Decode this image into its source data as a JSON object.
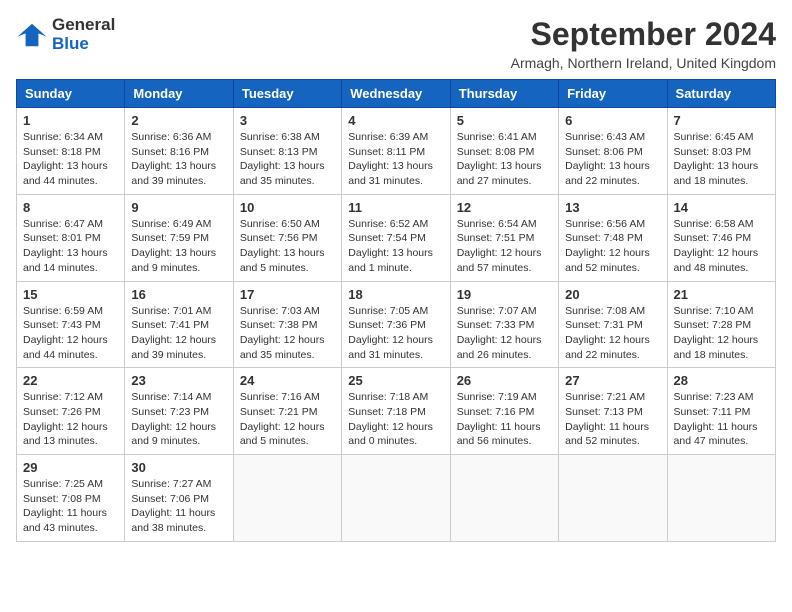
{
  "logo": {
    "line1": "General",
    "line2": "Blue"
  },
  "title": "September 2024",
  "subtitle": "Armagh, Northern Ireland, United Kingdom",
  "days_of_week": [
    "Sunday",
    "Monday",
    "Tuesday",
    "Wednesday",
    "Thursday",
    "Friday",
    "Saturday"
  ],
  "weeks": [
    [
      {
        "day": 1,
        "info": "Sunrise: 6:34 AM\nSunset: 8:18 PM\nDaylight: 13 hours\nand 44 minutes."
      },
      {
        "day": 2,
        "info": "Sunrise: 6:36 AM\nSunset: 8:16 PM\nDaylight: 13 hours\nand 39 minutes."
      },
      {
        "day": 3,
        "info": "Sunrise: 6:38 AM\nSunset: 8:13 PM\nDaylight: 13 hours\nand 35 minutes."
      },
      {
        "day": 4,
        "info": "Sunrise: 6:39 AM\nSunset: 8:11 PM\nDaylight: 13 hours\nand 31 minutes."
      },
      {
        "day": 5,
        "info": "Sunrise: 6:41 AM\nSunset: 8:08 PM\nDaylight: 13 hours\nand 27 minutes."
      },
      {
        "day": 6,
        "info": "Sunrise: 6:43 AM\nSunset: 8:06 PM\nDaylight: 13 hours\nand 22 minutes."
      },
      {
        "day": 7,
        "info": "Sunrise: 6:45 AM\nSunset: 8:03 PM\nDaylight: 13 hours\nand 18 minutes."
      }
    ],
    [
      {
        "day": 8,
        "info": "Sunrise: 6:47 AM\nSunset: 8:01 PM\nDaylight: 13 hours\nand 14 minutes."
      },
      {
        "day": 9,
        "info": "Sunrise: 6:49 AM\nSunset: 7:59 PM\nDaylight: 13 hours\nand 9 minutes."
      },
      {
        "day": 10,
        "info": "Sunrise: 6:50 AM\nSunset: 7:56 PM\nDaylight: 13 hours\nand 5 minutes."
      },
      {
        "day": 11,
        "info": "Sunrise: 6:52 AM\nSunset: 7:54 PM\nDaylight: 13 hours\nand 1 minute."
      },
      {
        "day": 12,
        "info": "Sunrise: 6:54 AM\nSunset: 7:51 PM\nDaylight: 12 hours\nand 57 minutes."
      },
      {
        "day": 13,
        "info": "Sunrise: 6:56 AM\nSunset: 7:48 PM\nDaylight: 12 hours\nand 52 minutes."
      },
      {
        "day": 14,
        "info": "Sunrise: 6:58 AM\nSunset: 7:46 PM\nDaylight: 12 hours\nand 48 minutes."
      }
    ],
    [
      {
        "day": 15,
        "info": "Sunrise: 6:59 AM\nSunset: 7:43 PM\nDaylight: 12 hours\nand 44 minutes."
      },
      {
        "day": 16,
        "info": "Sunrise: 7:01 AM\nSunset: 7:41 PM\nDaylight: 12 hours\nand 39 minutes."
      },
      {
        "day": 17,
        "info": "Sunrise: 7:03 AM\nSunset: 7:38 PM\nDaylight: 12 hours\nand 35 minutes."
      },
      {
        "day": 18,
        "info": "Sunrise: 7:05 AM\nSunset: 7:36 PM\nDaylight: 12 hours\nand 31 minutes."
      },
      {
        "day": 19,
        "info": "Sunrise: 7:07 AM\nSunset: 7:33 PM\nDaylight: 12 hours\nand 26 minutes."
      },
      {
        "day": 20,
        "info": "Sunrise: 7:08 AM\nSunset: 7:31 PM\nDaylight: 12 hours\nand 22 minutes."
      },
      {
        "day": 21,
        "info": "Sunrise: 7:10 AM\nSunset: 7:28 PM\nDaylight: 12 hours\nand 18 minutes."
      }
    ],
    [
      {
        "day": 22,
        "info": "Sunrise: 7:12 AM\nSunset: 7:26 PM\nDaylight: 12 hours\nand 13 minutes."
      },
      {
        "day": 23,
        "info": "Sunrise: 7:14 AM\nSunset: 7:23 PM\nDaylight: 12 hours\nand 9 minutes."
      },
      {
        "day": 24,
        "info": "Sunrise: 7:16 AM\nSunset: 7:21 PM\nDaylight: 12 hours\nand 5 minutes."
      },
      {
        "day": 25,
        "info": "Sunrise: 7:18 AM\nSunset: 7:18 PM\nDaylight: 12 hours\nand 0 minutes."
      },
      {
        "day": 26,
        "info": "Sunrise: 7:19 AM\nSunset: 7:16 PM\nDaylight: 11 hours\nand 56 minutes."
      },
      {
        "day": 27,
        "info": "Sunrise: 7:21 AM\nSunset: 7:13 PM\nDaylight: 11 hours\nand 52 minutes."
      },
      {
        "day": 28,
        "info": "Sunrise: 7:23 AM\nSunset: 7:11 PM\nDaylight: 11 hours\nand 47 minutes."
      }
    ],
    [
      {
        "day": 29,
        "info": "Sunrise: 7:25 AM\nSunset: 7:08 PM\nDaylight: 11 hours\nand 43 minutes."
      },
      {
        "day": 30,
        "info": "Sunrise: 7:27 AM\nSunset: 7:06 PM\nDaylight: 11 hours\nand 38 minutes."
      },
      null,
      null,
      null,
      null,
      null
    ]
  ]
}
